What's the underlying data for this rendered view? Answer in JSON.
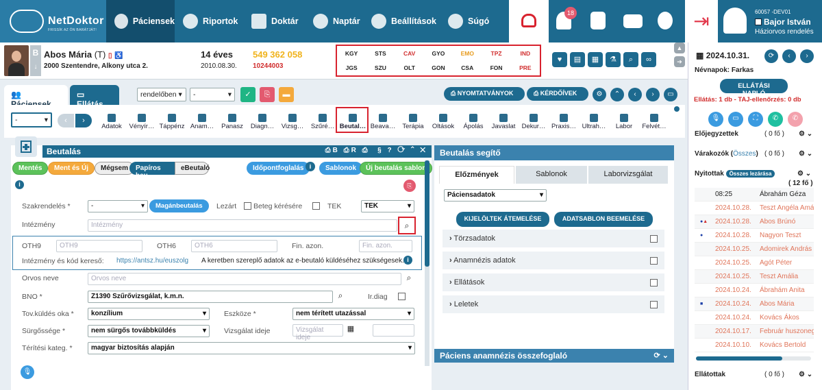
{
  "app": {
    "logo": "NetDoktor",
    "logo_sub": "FRISSÍK AZ ÖN BARÁTJÁT!"
  },
  "nav": {
    "items": [
      {
        "label": "Páciensek",
        "icon": "users-icon"
      },
      {
        "label": "Riportok",
        "icon": "pie-chart-icon"
      },
      {
        "label": "Doktár",
        "icon": "folders-icon"
      },
      {
        "label": "Naptár",
        "icon": "plane-icon"
      },
      {
        "label": "Beállítások",
        "icon": "gears-icon"
      },
      {
        "label": "Súgó",
        "icon": "chat-question-icon"
      }
    ],
    "notification_count": "18"
  },
  "user": {
    "code": "60057 -DEV01",
    "name": "Bajor István",
    "role": "Háziorvos rendelés"
  },
  "patient": {
    "name": "Abos Mária",
    "name_suffix": "(T)",
    "address": "2000 Szentendre, Alkony utca 2.",
    "age": "14 éves",
    "dob": "2010.08.30.",
    "taj": "549 362 058",
    "id": "10244003",
    "badge": "B"
  },
  "codes": [
    {
      "t": "KGY",
      "c": "#222"
    },
    {
      "t": "STS",
      "c": "#222"
    },
    {
      "t": "CAV",
      "c": "#d12e2e"
    },
    {
      "t": "GYO",
      "c": "#222"
    },
    {
      "t": "EMO",
      "c": "#e79b1e"
    },
    {
      "t": "TPZ",
      "c": "#d12e2e"
    },
    {
      "t": "IND",
      "c": "#d12e2e"
    },
    {
      "t": "JGS",
      "c": "#222"
    },
    {
      "t": "SZU",
      "c": "#222"
    },
    {
      "t": "OLT",
      "c": "#222"
    },
    {
      "t": "GON",
      "c": "#222"
    },
    {
      "t": "CSA",
      "c": "#222"
    },
    {
      "t": "FON",
      "c": "#222"
    },
    {
      "t": "PRE",
      "c": "#d12e2e"
    }
  ],
  "tabs": {
    "pac": "Páciensek",
    "ell": "Ellátás",
    "sel1": "rendelőben",
    "sel2": "-",
    "sel3": "-",
    "nyomt": "NYOMTATVÁNYOK",
    "kerd": "KÉRDŐÍVEK"
  },
  "iconrow": [
    "Adatok",
    "Vényír…",
    "Táppénz",
    "Anam…",
    "Panasz",
    "Diagn…",
    "Vizsg…",
    "Szűré…",
    "Beutal…",
    "Beava…",
    "Terápia",
    "Oltások",
    "Ápolás",
    "Javaslat",
    "Dekur…",
    "Praxis…",
    "Ultrah…",
    "Labor",
    "Felvét…"
  ],
  "beutalas": {
    "title": "Beutalás",
    "btn_mentes": "Mentés",
    "btn_ment_uj": "Ment és Új",
    "btn_megsem": "Mégsem",
    "btn_papiros": "Papíros beu.",
    "btn_ebeutalo": "eBeutaló",
    "btn_idopont": "Időpontfoglalás",
    "btn_sablonok": "Sablonok",
    "btn_uj_sablon": "Új beutalás sablon",
    "lbl_szakrend": "Szakrendelés *",
    "szakrend_val": "-",
    "btn_maganbeut": "Magánbeutalás",
    "lbl_lezart": "Lezárt",
    "lbl_beteg": "Beteg kérésére",
    "lbl_tek": "TEK",
    "tek_val": "TEK",
    "lbl_intezmeny": "Intézmény",
    "ph_intezmeny": "Intézmény",
    "lbl_oth9": "OTH9",
    "ph_oth9": "OTH9",
    "lbl_oth6": "OTH6",
    "ph_oth6": "OTH6",
    "lbl_fin": "Fin. azon.",
    "ph_fin": "Fin. azon.",
    "lbl_kodkereso": "Intézmény és kód kereső:",
    "link": "https://antsz.hu/euszolg",
    "note": "A keretben szereplő adatok az e-beutaló küldéséhez szükségesek.",
    "lbl_orvos": "Orvos neve",
    "ph_orvos": "Orvos neve",
    "lbl_bno": "BNO *",
    "bno_val": "Z1390 Szűrővizsgálat, k.m.n.",
    "lbl_irdiag": "Ir.diag",
    "lbl_tovkuld": "Tov.küldés oka *",
    "tovkuld_val": "konzílium",
    "lbl_eszkoze": "Eszköze *",
    "eszkoze_val": "nem térített utazással",
    "lbl_surg": "Sürgőssége *",
    "surg_val": "nem sürgős továbbküldés",
    "lbl_vizsg": "Vizsgálat ideje",
    "ph_vizsg": "Vizsgálat ideje",
    "lbl_terit": "Térítési kateg. *",
    "terit_val": "magyar biztosítás alapján"
  },
  "segito": {
    "title": "Beutalás segítő",
    "tabs": [
      "Előzmények",
      "Sablonok",
      "Laborvizsgálat"
    ],
    "select": "Páciensadatok",
    "btn1": "KIJELÖLTEK ÁTEMELÉSE",
    "btn2": "ADATSABLON BEEMELÉSE",
    "acc": [
      "Törzsadatok",
      "Anamnézis adatok",
      "Ellátások",
      "Leletek"
    ],
    "summary": "Páciens anamnézis összefoglaló"
  },
  "side": {
    "date": "2024.10.31.",
    "nevnap": "Névnapok: Farkas",
    "naplo": "ELLÁTÁSI NAPLÓ",
    "warn": "Ellátás: 1 db - TAJ-ellenőrzés: 0 db",
    "elojegy": "Előjegyzettek",
    "elojegy_c": "( 0 fő )",
    "varakozok": "Várakozók",
    "osszes": "Összes",
    "varak_c": "( 0 fő )",
    "nyitottak": "Nyitottak",
    "lezaras": "Összes lezárása",
    "nyit_c": "( 12 fő )",
    "ellatottak": "Ellátottak",
    "ellat_c": "( 0 fő )",
    "rows": [
      {
        "d": "08:25",
        "n": "Ábrahám Géza",
        "c": "#222",
        "mk": ""
      },
      {
        "d": "2024.10.28.",
        "n": "Teszt Angéla Amál…",
        "c": "#e0755a",
        "mk": ""
      },
      {
        "d": "2024.10.28.",
        "n": "Abos Brúnó",
        "c": "#e0755a",
        "mk": "dots"
      },
      {
        "d": "2024.10.28.",
        "n": "Nagyon Teszt",
        "c": "#e0755a",
        "mk": "dot"
      },
      {
        "d": "2024.10.25.",
        "n": "Adomirek András",
        "c": "#e0755a",
        "mk": ""
      },
      {
        "d": "2024.10.25.",
        "n": "Agót Péter",
        "c": "#e0755a",
        "mk": ""
      },
      {
        "d": "2024.10.25.",
        "n": "Teszt Amália",
        "c": "#e0755a",
        "mk": ""
      },
      {
        "d": "2024.10.24.",
        "n": "Ábrahám Anita",
        "c": "#e0755a",
        "mk": ""
      },
      {
        "d": "2024.10.24.",
        "n": "Abos Mária",
        "c": "#e0755a",
        "mk": "sq"
      },
      {
        "d": "2024.10.24.",
        "n": "Kovács Ákos",
        "c": "#e0755a",
        "mk": ""
      },
      {
        "d": "2024.10.17.",
        "n": "Február huszonegy",
        "c": "#e0755a",
        "mk": ""
      },
      {
        "d": "2024.10.10.",
        "n": "Kovács Bertold",
        "c": "#e0755a",
        "mk": ""
      }
    ]
  }
}
